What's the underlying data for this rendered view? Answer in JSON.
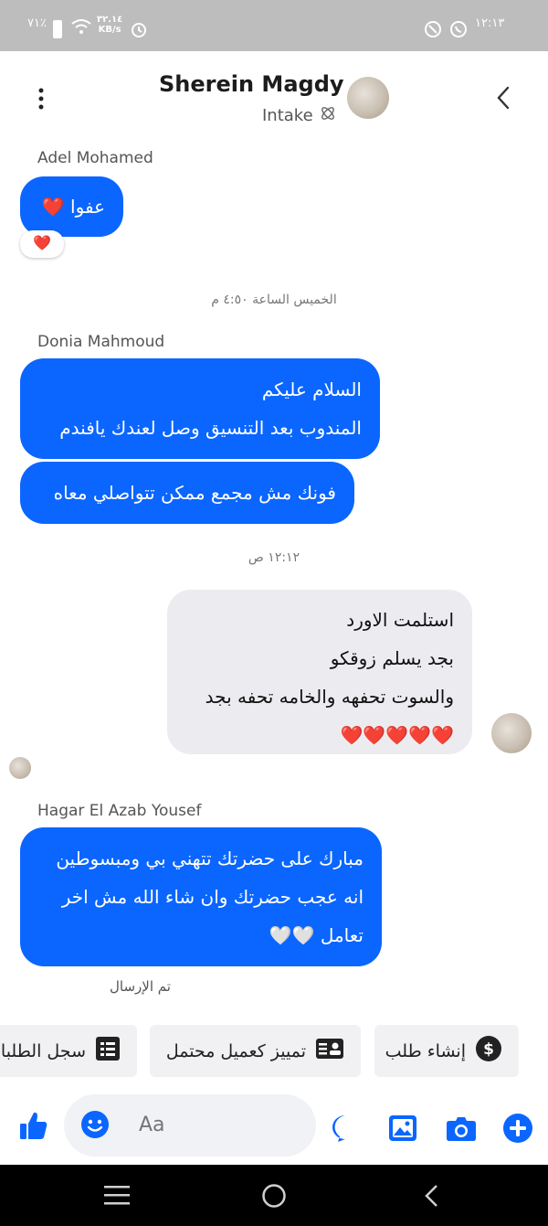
{
  "status_bar": {
    "battery": "٧١٪",
    "net_speed_value": "٣٢.١٤",
    "net_speed_unit": "KB/s",
    "time": "١٢:١٣"
  },
  "header": {
    "title": "Sherein Magdy",
    "subtitle": "Intake"
  },
  "messages": [
    {
      "sender": "Adel Mohamed",
      "text": "عفوا ❤️",
      "reaction": "❤️"
    },
    {
      "timestamp": "الخميس الساعة ٤:٥٠ م"
    },
    {
      "sender": "Donia Mahmoud",
      "lines": [
        "السلام عليكم",
        "المندوب بعد التنسيق وصل لعندك يافندم"
      ]
    },
    {
      "text": "فونك مش مجمع ممكن تتواصلي معاه"
    },
    {
      "timestamp": "١٢:١٢ ص"
    },
    {
      "lines": [
        "استلمت الاورد",
        "بجد يسلم زوقكو",
        "والسوت تحفهه والخامه تحفه بجد",
        "❤️❤️❤️❤️❤️"
      ]
    },
    {
      "sender": "Hagar El Azab Yousef",
      "lines": [
        "مبارك على حضرتك تتهني بي ومبسوطين",
        "انه عجب حضرتك وان شاء الله مش اخر",
        "تعامل 🤍🤍"
      ]
    },
    {
      "status": "تم الإرسال"
    }
  ],
  "quick_actions": [
    {
      "label": "إنشاء طلب",
      "icon": "dollar-icon"
    },
    {
      "label": "تمييز كعميل محتمل",
      "icon": "contact-card-icon"
    },
    {
      "label": "سجل الطلبا",
      "icon": "list-icon"
    }
  ],
  "composer": {
    "placeholder": "Aa"
  },
  "colors": {
    "accent": "#0a66ff",
    "incoming_bubble": "#0a66ff",
    "outgoing_bubble": "#ececf0",
    "heart": "#e8192c"
  }
}
